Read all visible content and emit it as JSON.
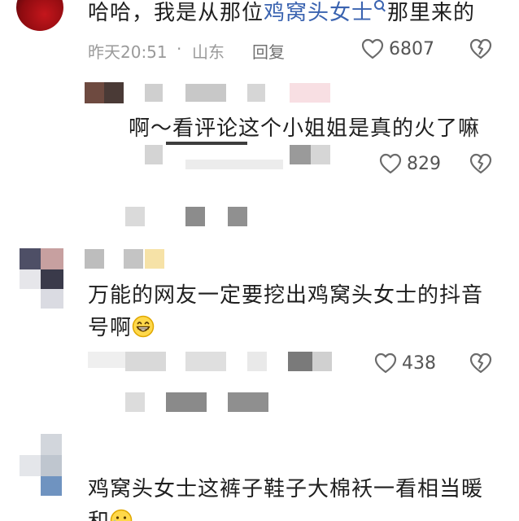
{
  "comments": [
    {
      "text_prefix": "哈哈，我是从那位",
      "link_text": "鸡窝头女士",
      "text_suffix": "那里来的",
      "time": "昨天20:51",
      "location": "山东",
      "reply_label": "回复",
      "likes": "6807"
    },
    {
      "text": "啊～看评论这个小姐姐是真的火了嘛",
      "likes": "829"
    },
    {
      "text_line1": "万能的网友一定要挖出鸡窝头女士的抖音",
      "text_line2": "号啊",
      "emoji": "grinning-face",
      "likes": "438"
    },
    {
      "text_line1": "鸡窝头女士这裤子鞋子大棉袄一看相当暖",
      "text_line2": "和",
      "emoji": "crying-face"
    }
  ],
  "colors": {
    "link": "#3a63b0",
    "text": "#1f1f1f",
    "meta": "#9a9a9a",
    "icon": "#6b6b6b"
  }
}
